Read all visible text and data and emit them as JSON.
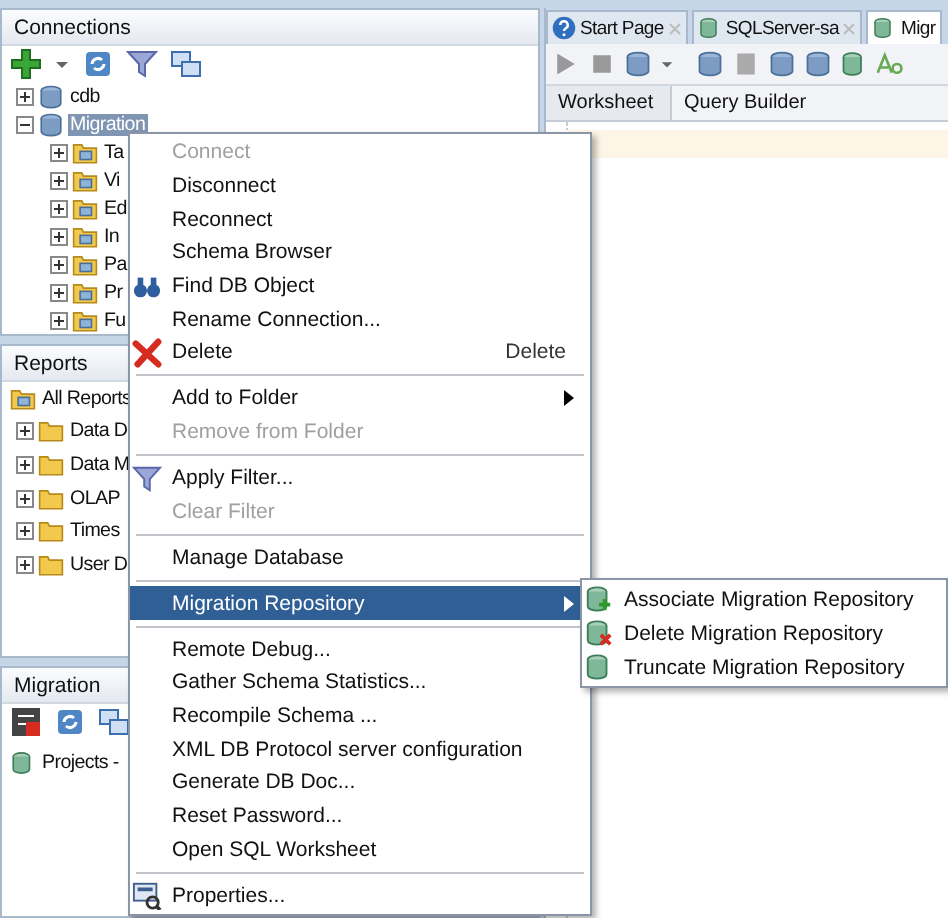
{
  "connections": {
    "title": "Connections",
    "tree": [
      {
        "label": "cdb",
        "expanded": false,
        "selected": false
      },
      {
        "label": "Migration",
        "expanded": true,
        "selected": true,
        "children": [
          {
            "label": "Ta",
            "expanded": false,
            "selected": false
          },
          {
            "label": "Vi",
            "expanded": false,
            "selected": false
          },
          {
            "label": "Ed",
            "expanded": false,
            "selected": false
          },
          {
            "label": "In",
            "expanded": false,
            "selected": false
          },
          {
            "label": "Pa",
            "expanded": false,
            "selected": false
          },
          {
            "label": "Pr",
            "expanded": false,
            "selected": false
          },
          {
            "label": "Fu",
            "expanded": false,
            "selected": false
          }
        ]
      }
    ]
  },
  "reports": {
    "title": "Reports",
    "tree": [
      {
        "label": "All Reports",
        "selected": false,
        "children": [
          {
            "label": "Data D",
            "expanded": false,
            "selected": false
          },
          {
            "label": "Data M",
            "expanded": false,
            "selected": false
          },
          {
            "label": "OLAP",
            "expanded": false,
            "selected": false
          },
          {
            "label": "Times",
            "expanded": false,
            "selected": false
          },
          {
            "label": "User D",
            "expanded": false,
            "selected": false
          }
        ]
      }
    ]
  },
  "migration": {
    "title": "Migration",
    "tree": [
      {
        "label": "Projects -",
        "selected": false
      }
    ]
  },
  "editor_tabs": [
    {
      "label": "Start Page",
      "selected": false
    },
    {
      "label": "SQLServer-sa",
      "selected": false
    },
    {
      "label": "Migr",
      "selected": true
    }
  ],
  "worksheet_tabs": [
    {
      "label": "Worksheet",
      "selected": true
    },
    {
      "label": "Query Builder",
      "selected": false
    }
  ],
  "context_menu": [
    {
      "kind": "item",
      "label": "Connect",
      "disabled": true,
      "selected": false
    },
    {
      "kind": "item",
      "label": "Disconnect",
      "disabled": false,
      "selected": false
    },
    {
      "kind": "item",
      "label": "Reconnect",
      "disabled": false,
      "selected": false
    },
    {
      "kind": "item",
      "label": "Schema Browser",
      "disabled": false,
      "selected": false
    },
    {
      "kind": "item",
      "label": "Find DB Object",
      "disabled": false,
      "selected": false
    },
    {
      "kind": "item",
      "label": "Rename Connection...",
      "disabled": false,
      "selected": false
    },
    {
      "kind": "item",
      "label": "Delete",
      "shortcut": "Delete",
      "disabled": false,
      "selected": false
    },
    {
      "kind": "separator"
    },
    {
      "kind": "submenu",
      "label": "Add to Folder",
      "disabled": false,
      "selected": false
    },
    {
      "kind": "item",
      "label": "Remove from Folder",
      "disabled": true,
      "selected": false
    },
    {
      "kind": "separator"
    },
    {
      "kind": "item",
      "label": "Apply Filter...",
      "disabled": false,
      "selected": false
    },
    {
      "kind": "item",
      "label": "Clear Filter",
      "disabled": true,
      "selected": false
    },
    {
      "kind": "separator"
    },
    {
      "kind": "item",
      "label": "Manage Database",
      "disabled": false,
      "selected": false
    },
    {
      "kind": "separator"
    },
    {
      "kind": "submenu",
      "label": "Migration Repository",
      "disabled": false,
      "selected": true
    },
    {
      "kind": "separator"
    },
    {
      "kind": "item",
      "label": "Remote Debug...",
      "disabled": false,
      "selected": false
    },
    {
      "kind": "item",
      "label": "Gather Schema Statistics...",
      "disabled": false,
      "selected": false
    },
    {
      "kind": "item",
      "label": "Recompile Schema ...",
      "disabled": false,
      "selected": false
    },
    {
      "kind": "item",
      "label": "XML DB Protocol server configuration",
      "disabled": false,
      "selected": false
    },
    {
      "kind": "item",
      "label": "Generate DB Doc...",
      "disabled": false,
      "selected": false
    },
    {
      "kind": "item",
      "label": "Reset Password...",
      "disabled": false,
      "selected": false
    },
    {
      "kind": "item",
      "label": "Open SQL Worksheet",
      "disabled": false,
      "selected": false
    },
    {
      "kind": "separator"
    },
    {
      "kind": "item",
      "label": "Properties...",
      "disabled": false,
      "selected": false
    }
  ],
  "submenu": [
    {
      "label": "Associate Migration Repository",
      "selected": false
    },
    {
      "label": "Delete Migration Repository",
      "selected": false
    },
    {
      "label": "Truncate Migration Repository",
      "selected": false
    }
  ]
}
